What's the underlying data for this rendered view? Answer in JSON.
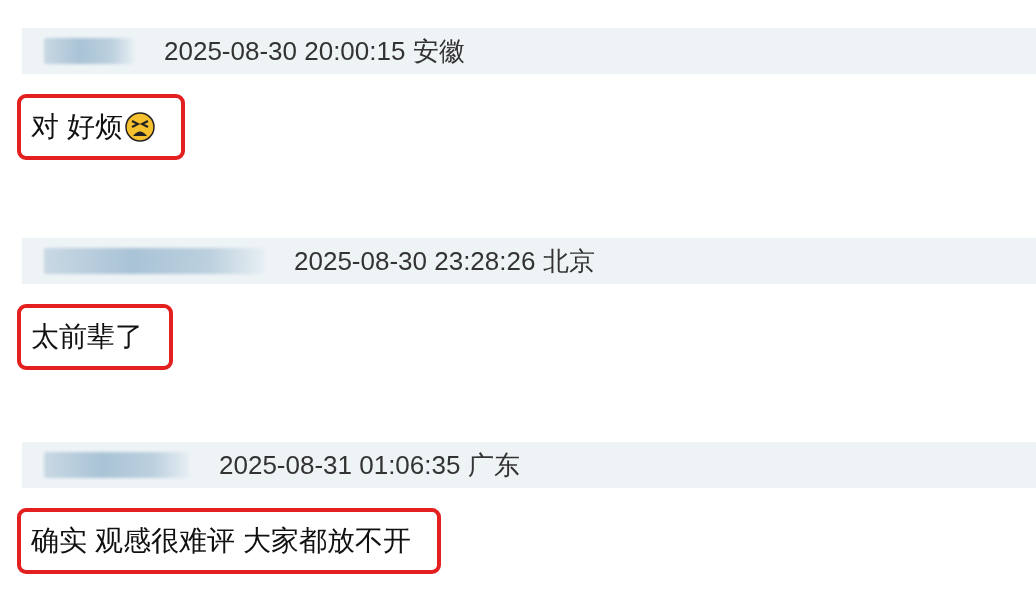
{
  "comments": [
    {
      "kind": "with-emoji",
      "timestamp": "2025-08-30 20:00:15",
      "location": "安徽",
      "text": "对 好烦"
    },
    {
      "kind": "plain",
      "timestamp": "2025-08-30 23:28:26",
      "location": "北京",
      "text": "太前辈了"
    },
    {
      "kind": "plain",
      "timestamp": "2025-08-31 01:06:35",
      "location": "广东",
      "text": "确实 观感很难评 大家都放不开"
    }
  ]
}
